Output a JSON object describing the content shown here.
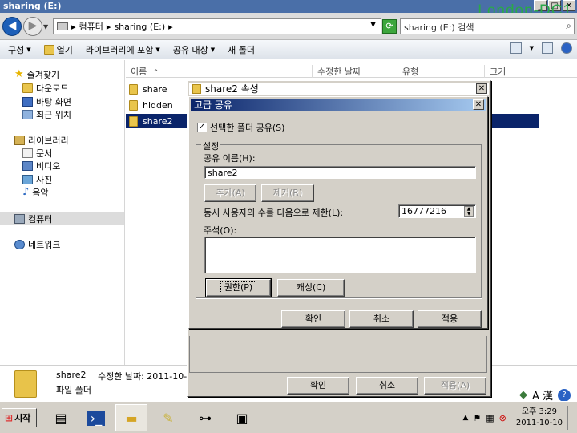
{
  "window": {
    "title": "sharing (E:)",
    "watermark": "London-DC1"
  },
  "address": {
    "segments": [
      "컴퓨터",
      "sharing (E:)"
    ],
    "search_placeholder": "sharing (E:) 검색"
  },
  "toolbar": {
    "items": [
      "구성",
      "열기",
      "라이브러리에 포함",
      "공유 대상",
      "새 폴더"
    ]
  },
  "nav": {
    "favorites": "즐겨찾기",
    "favorite_items": [
      "다운로드",
      "바탕 화면",
      "최근 위치"
    ],
    "libraries": "라이브러리",
    "library_items": [
      "문서",
      "비디오",
      "사진",
      "음악"
    ],
    "computer": "컴퓨터",
    "network": "네트워크"
  },
  "filelist": {
    "columns": [
      "이름",
      "수정한 날짜",
      "유형",
      "크기"
    ],
    "sort_indicator": "^",
    "rows": [
      {
        "name": "share",
        "selected": false
      },
      {
        "name": "hidden",
        "selected": false
      },
      {
        "name": "share2",
        "selected": true
      }
    ]
  },
  "details": {
    "name": "share2",
    "modified_label": "수정한 날짜: 2011-10-",
    "type": "파일 폴더"
  },
  "props_dialog": {
    "title": "share2 속성",
    "ok": "확인",
    "cancel": "취소",
    "apply": "적용(A)"
  },
  "adv_dialog": {
    "title": "고급 공유",
    "share_checkbox": "선택한 폴더 공유(S)",
    "share_checked": true,
    "settings_label": "설정",
    "share_name_label": "공유 이름(H):",
    "share_name_value": "share2",
    "add_btn": "추가(A)",
    "remove_btn": "제거(R)",
    "limit_label": "동시 사용자의 수를 다음으로 제한(L):",
    "limit_value": "16777216",
    "comment_label": "주석(O):",
    "comment_value": "",
    "perm_btn": "권한(P)",
    "cache_btn": "캐싱(C)",
    "ok": "확인",
    "cancel": "취소",
    "apply": "적용"
  },
  "taskbar": {
    "start": "시작",
    "tray_lang": "A 漢",
    "time": "오후 3:29",
    "date": "2011-10-10"
  }
}
